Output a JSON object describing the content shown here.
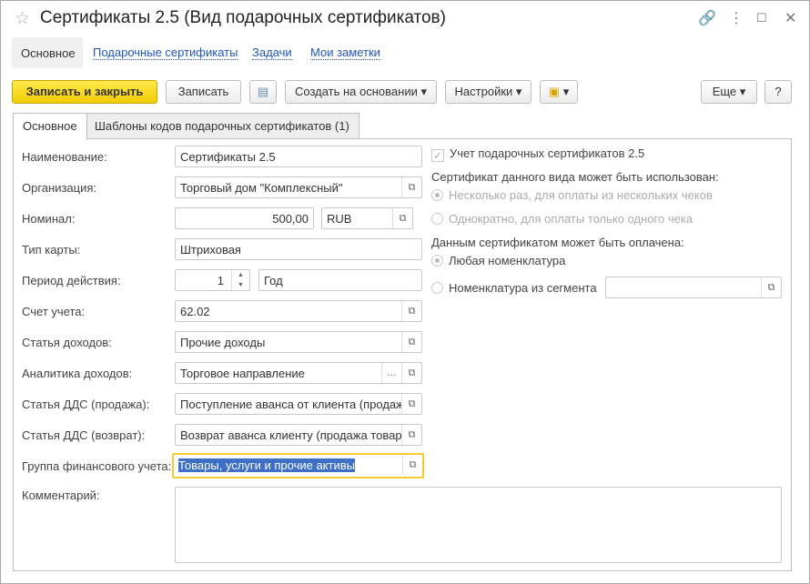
{
  "window": {
    "title": "Сертификаты 2.5 (Вид подарочных сертификатов)",
    "star": "☆",
    "link_icon": "🔗",
    "menu_icon": "⋮",
    "max_icon": "☐",
    "close_icon": "✕"
  },
  "nav": {
    "items": [
      "Основное",
      "Подарочные сертификаты",
      "Задачи",
      "Мои заметки"
    ]
  },
  "toolbar": {
    "save_close": "Записать и закрыть",
    "save": "Записать",
    "create_based": "Создать на основании ▾",
    "settings": "Настройки ▾",
    "report_icon": "▾",
    "more": "Еще ▾",
    "help": "?"
  },
  "tabs": [
    "Основное",
    "Шаблоны кодов подарочных сертификатов (1)"
  ],
  "fields": {
    "name": {
      "label": "Наименование:",
      "value": "Сертификаты 2.5"
    },
    "org": {
      "label": "Организация:",
      "value": "Торговый дом \"Комплексный\""
    },
    "nominal": {
      "label": "Номинал:",
      "value": "500,00",
      "currency": "RUB"
    },
    "card_type": {
      "label": "Тип карты:",
      "value": "Штриховая"
    },
    "period": {
      "label": "Период действия:",
      "value": "1",
      "unit": "Год"
    },
    "account": {
      "label": "Счет учета:",
      "value": "62.02"
    },
    "income": {
      "label": "Статья доходов:",
      "value": "Прочие доходы"
    },
    "income_analytics": {
      "label": "Аналитика доходов:",
      "value": "Торговое направление"
    },
    "dds_sale": {
      "label": "Статья ДДС (продажа):",
      "value": "Поступление аванса от клиента (продаж"
    },
    "dds_return": {
      "label": "Статья ДДС (возврат):",
      "value": "Возврат аванса клиенту (продажа товар"
    },
    "fin_group": {
      "label": "Группа финансового учета:",
      "value": "Товары, услуги и прочие активы"
    },
    "comment": {
      "label": "Комментарий:",
      "value": ""
    }
  },
  "right": {
    "accounting": "Учет подарочных сертификатов 2.5",
    "usage_label": "Сертификат данного вида может быть использован:",
    "usage_options": [
      "Несколько раз, для оплаты из нескольких чеков",
      "Однократно, для оплаты только одного чека"
    ],
    "pay_label": "Данным сертификатом может быть оплачена:",
    "pay_options": [
      "Любая номенклатура",
      "Номенклатура из сегмента"
    ],
    "segment_value": ""
  }
}
